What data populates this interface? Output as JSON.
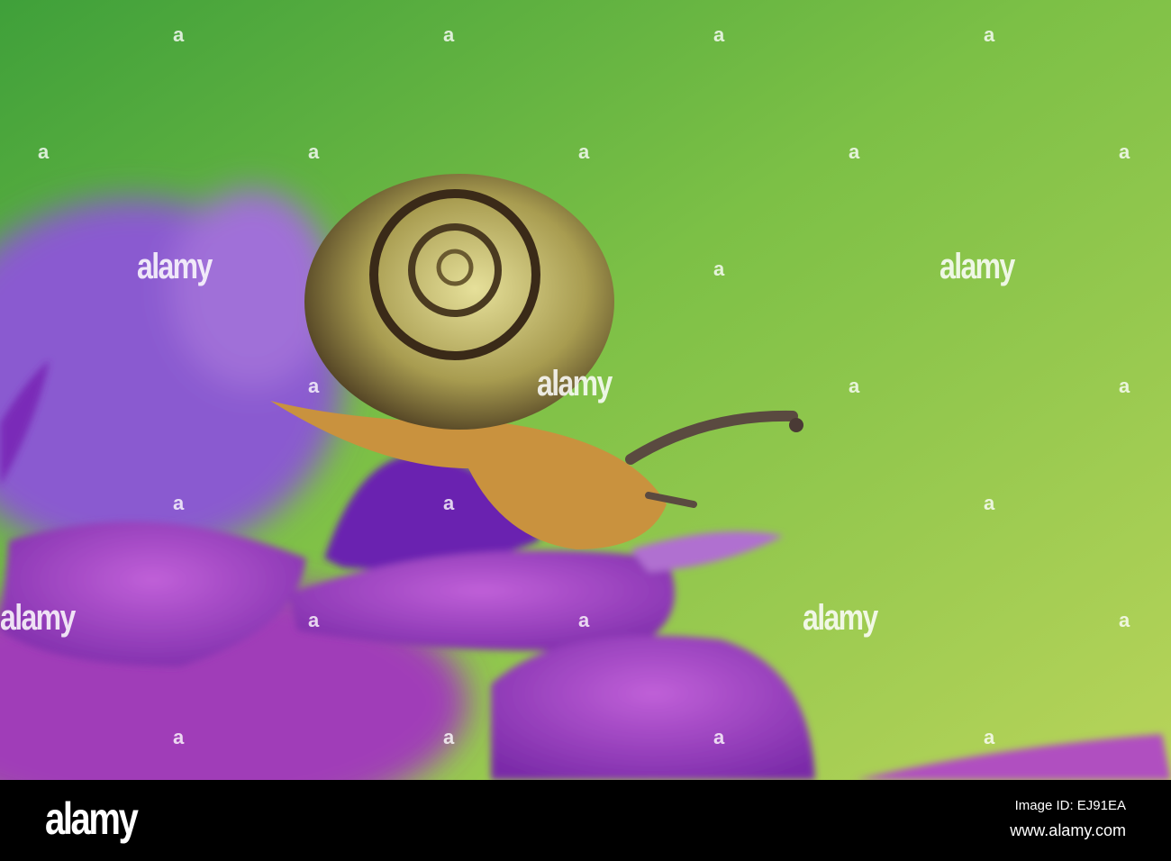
{
  "photo": {
    "subject": "snail-on-hydrangea",
    "colors": {
      "background_green": "#8cc34a",
      "petal_purple": "#9a3fc0",
      "shell": "#b6a95a"
    }
  },
  "watermark": {
    "text": "alamy",
    "mark": "a"
  },
  "footer": {
    "logo": "alamy",
    "image_id": "Image ID: EJ91EA",
    "website": "www.alamy.com"
  }
}
